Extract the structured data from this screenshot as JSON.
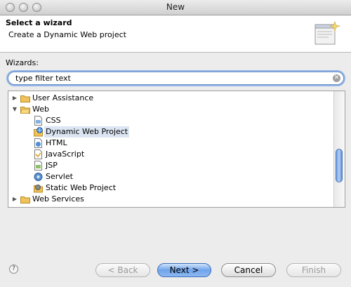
{
  "window": {
    "title": "New"
  },
  "banner": {
    "title": "Select a wizard",
    "message": "Create a Dynamic Web project",
    "icon": "wizard-banner-icon"
  },
  "wizards_label": "Wizards:",
  "filter": {
    "value": "type filter text",
    "clear_icon": "clear-search-icon"
  },
  "tree": {
    "items": [
      {
        "label": "User Assistance",
        "type": "folder",
        "expanded": false,
        "depth": 0
      },
      {
        "label": "Web",
        "type": "folder",
        "expanded": true,
        "depth": 0
      },
      {
        "label": "CSS",
        "type": "file",
        "depth": 1
      },
      {
        "label": "Dynamic Web Project",
        "type": "project",
        "depth": 1,
        "selected": true
      },
      {
        "label": "HTML",
        "type": "file",
        "depth": 1
      },
      {
        "label": "JavaScript",
        "type": "file",
        "depth": 1
      },
      {
        "label": "JSP",
        "type": "file",
        "depth": 1
      },
      {
        "label": "Servlet",
        "type": "file",
        "depth": 1
      },
      {
        "label": "Static Web Project",
        "type": "project",
        "depth": 1
      },
      {
        "label": "Web Services",
        "type": "folder",
        "expanded": false,
        "depth": 0
      }
    ]
  },
  "buttons": {
    "help": "?",
    "back": "< Back",
    "next": "Next >",
    "cancel": "Cancel",
    "finish": "Finish"
  },
  "colors": {
    "accent": "#6fa3ea",
    "selection": "#dce6f3"
  }
}
